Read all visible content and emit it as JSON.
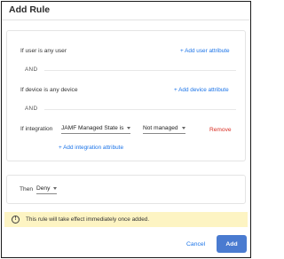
{
  "dialog": {
    "title": "Add Rule"
  },
  "conditions": {
    "user_text": "If user is any user",
    "add_user_attribute": "+ Add user attribute",
    "and_1": "AND",
    "device_text": "If device is any device",
    "add_device_attribute": "+ Add device attribute",
    "and_2": "AND",
    "integration_prefix": "If integration",
    "integration_field": "JAMF Managed State is",
    "integration_value": "Not managed",
    "remove": "Remove",
    "add_integration_attribute": "+ Add integration attribute"
  },
  "action": {
    "then_label": "Then",
    "then_value": "Deny"
  },
  "banner": {
    "icon": "exclamation-circle-icon",
    "text": "This rule will take effect immediately once added."
  },
  "footer": {
    "cancel": "Cancel",
    "add": "Add"
  }
}
